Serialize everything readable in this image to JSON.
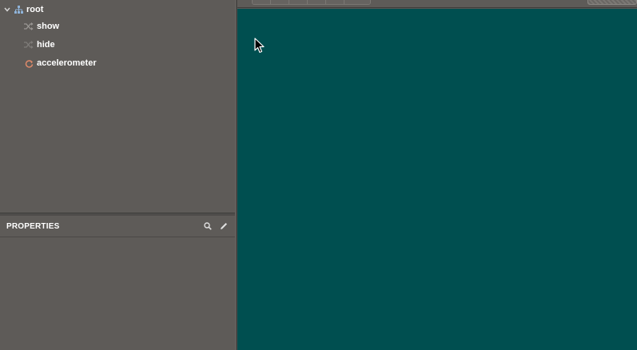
{
  "tree": {
    "root": {
      "label": "root",
      "icon": "hierarchy-icon",
      "expanded": true
    },
    "children": [
      {
        "label": "show",
        "icon": "shuffle-icon"
      },
      {
        "label": "hide",
        "icon": "shuffle-icon"
      },
      {
        "label": "accelerometer",
        "icon": "refresh-icon"
      }
    ]
  },
  "properties": {
    "title": "PROPERTIES",
    "tools": [
      "search-icon",
      "pencil-icon"
    ]
  },
  "colors": {
    "panel_bg": "#5e5b58",
    "canvas_bg": "#004f50",
    "accent_icon": "#8fb3d9",
    "accelerometer_icon": "#e08a6a"
  }
}
